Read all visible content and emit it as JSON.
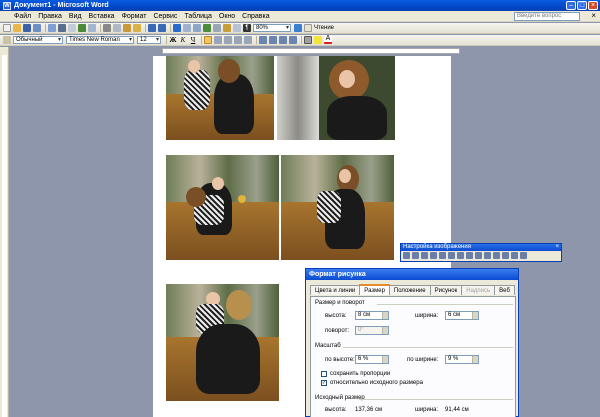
{
  "window": {
    "title": "Документ1 - Microsoft Word"
  },
  "menu": {
    "items": [
      "Файл",
      "Правка",
      "Вид",
      "Вставка",
      "Формат",
      "Сервис",
      "Таблица",
      "Окно",
      "Справка"
    ],
    "help_placeholder": "Введите вопрос"
  },
  "toolbar": {
    "zoom": "80%",
    "reading_label": "Чтение"
  },
  "format_bar": {
    "style": "Обычный",
    "font": "Times New Roman",
    "size": "12",
    "bold": "Ж",
    "italic": "К",
    "underline": "Ч"
  },
  "picture_toolbar": {
    "title": "Настройка изображения"
  },
  "dialog": {
    "title": "Формат рисунка",
    "tabs": [
      "Цвета и линии",
      "Размер",
      "Положение",
      "Рисунок",
      "Надпись",
      "Веб"
    ],
    "active_tab": "Размер",
    "disabled_tab": "Надпись",
    "size_group": "Размер и поворот",
    "height_label": "высота:",
    "height_value": "8 см",
    "width_label": "ширина:",
    "width_value": "6 см",
    "rotation_label": "поворот:",
    "rotation_value": "0°",
    "scale_group": "Масштаб",
    "scale_h_label": "по высоте:",
    "scale_h_value": "6 %",
    "scale_w_label": "по ширине:",
    "scale_w_value": "9 %",
    "keep_ratio": "сохранить пропорции",
    "relative": "относительно исходного размера",
    "original_group": "Исходный размер",
    "orig_h_label": "высота:",
    "orig_h_value": "137,36 см",
    "orig_w_label": "ширина:",
    "orig_w_value": "91,44 см"
  }
}
